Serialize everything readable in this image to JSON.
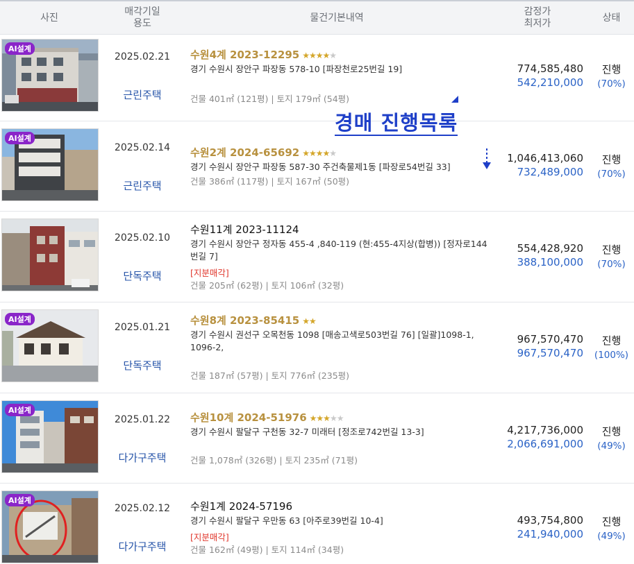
{
  "header": {
    "photo": "사진",
    "date_line1": "매각기일",
    "date_line2": "용도",
    "basic": "물건기본내역",
    "price_line1": "감정가",
    "price_line2": "최저가",
    "status": "상태"
  },
  "overlay": {
    "title": "경매 진행목록"
  },
  "rows": [
    {
      "ai_badge": "AI설계",
      "date": "2025.02.21",
      "usage": "근린주택",
      "case": "수원4계 2023-12295",
      "stars": {
        "on": "★★★★",
        "off": "★"
      },
      "address": "경기 수원시 장안구 파장동 578-10 [파장천로25번길 19]",
      "share": "",
      "area": "건물 401㎡ (121평)   |   토지 179㎡ (54평)",
      "appraisal": "774,585,480",
      "minimum": "542,210,000",
      "state": "진행",
      "percent": "(70%)"
    },
    {
      "ai_badge": "AI설계",
      "date": "2025.02.14",
      "usage": "근린주택",
      "case": "수원2계 2024-65692",
      "stars": {
        "on": "★★★★",
        "off": "★"
      },
      "address": "경기 수원시 장안구 파장동 587-30 주건축물제1동 [파장로54번길 33]",
      "share": "",
      "area": "건물 386㎡ (117평)   |   토지 167㎡ (50평)",
      "appraisal": "1,046,413,060",
      "minimum": "732,489,000",
      "state": "진행",
      "percent": "(70%)"
    },
    {
      "ai_badge": "",
      "date": "2025.02.10",
      "usage": "단독주택",
      "case": "수원11계 2023-11124",
      "stars": {
        "on": "",
        "off": ""
      },
      "address": "경기 수원시 장안구 정자동 455-4 ,840-119 (현:455-4지상(합병)) [정자로144번길 7]",
      "share": "[지분매각]",
      "area": "건물 205㎡ (62평)   |   토지 106㎡ (32평)",
      "appraisal": "554,428,920",
      "minimum": "388,100,000",
      "state": "진행",
      "percent": "(70%)"
    },
    {
      "ai_badge": "AI설계",
      "date": "2025.01.21",
      "usage": "단독주택",
      "case": "수원8계 2023-85415",
      "stars": {
        "on": "★★",
        "off": ""
      },
      "address": "경기 수원시 권선구 오목천동 1098 [매송고색로503번길 76]  [일괄]1098-1, 1096-2,",
      "share": "",
      "area": "건물 187㎡ (57평)   |   토지 776㎡ (235평)",
      "appraisal": "967,570,470",
      "minimum": "967,570,470",
      "state": "진행",
      "percent": "(100%)"
    },
    {
      "ai_badge": "AI설계",
      "date": "2025.01.22",
      "usage": "다가구주택",
      "case": "수원10계 2024-51976",
      "stars": {
        "on": "★★★",
        "off": "★★"
      },
      "address": "경기 수원시 팔달구 구천동 32-7 미래터 [정조로742번길 13-3]",
      "share": "",
      "area": "건물 1,078㎡ (326평)   |   토지 235㎡ (71평)",
      "appraisal": "4,217,736,000",
      "minimum": "2,066,691,000",
      "state": "진행",
      "percent": "(49%)"
    },
    {
      "ai_badge": "AI설계",
      "date": "2025.02.12",
      "usage": "다가구주택",
      "case": "수원1계 2024-57196",
      "stars": {
        "on": "",
        "off": ""
      },
      "address": "경기 수원시 팔달구 우만동 63 [아주로39번길 10-4]",
      "share": "[지분매각]",
      "area": "건물 162㎡ (49평)   |   토지 114㎡ (34평)",
      "appraisal": "493,754,800",
      "minimum": "241,940,000",
      "state": "진행",
      "percent": "(49%)"
    }
  ]
}
